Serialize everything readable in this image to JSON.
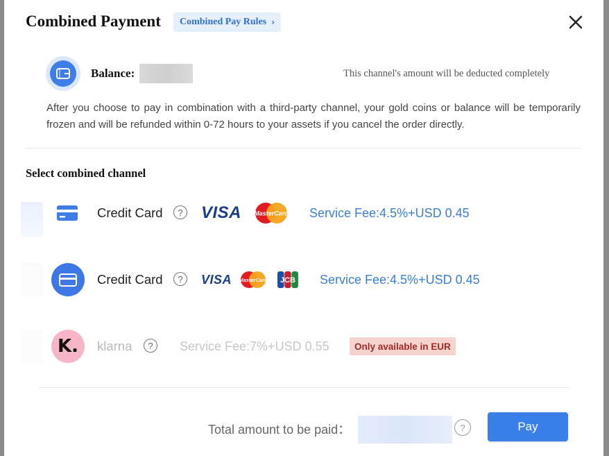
{
  "modal": {
    "title": "Combined Payment",
    "rules_link": "Combined Pay Rules"
  },
  "balance": {
    "label": "Balance:",
    "value": "",
    "deduct_note": "This channel's amount will be deducted completely",
    "info_text": "After you choose to pay in combination with a third-party channel, your gold coins or balance will be temporarily frozen and will be refunded within 0-72 hours to your assets if you cancel the order directly."
  },
  "channels": {
    "section_title": "Select combined channel",
    "items": [
      {
        "label": "Credit Card",
        "help": "?",
        "brands": [
          "VISA",
          "MasterCard"
        ],
        "fee": "Service Fee:4.5%+USD 0.45",
        "disabled": false
      },
      {
        "label": "Credit Card",
        "help": "?",
        "brands": [
          "VISA",
          "MasterCard",
          "JCB"
        ],
        "fee": "Service Fee:4.5%+USD 0.45",
        "disabled": false
      },
      {
        "label": "klarna",
        "help": "?",
        "fee": "Service Fee:7%+USD 0.55",
        "badge": "Only available in EUR",
        "disabled": true
      }
    ]
  },
  "footer": {
    "total_label": "Total amount to be paid：",
    "total_value": "",
    "help": "?",
    "pay_label": "Pay"
  },
  "colors": {
    "accent": "#3b80e8",
    "fee_text": "#3a7fd6",
    "warning_bg": "#f5d4d0",
    "warning_text": "#a32a22"
  },
  "icons": [
    "close-icon",
    "wallet-icon",
    "card-icon",
    "help-icon",
    "klarna-icon",
    "chevron-right-icon"
  ]
}
